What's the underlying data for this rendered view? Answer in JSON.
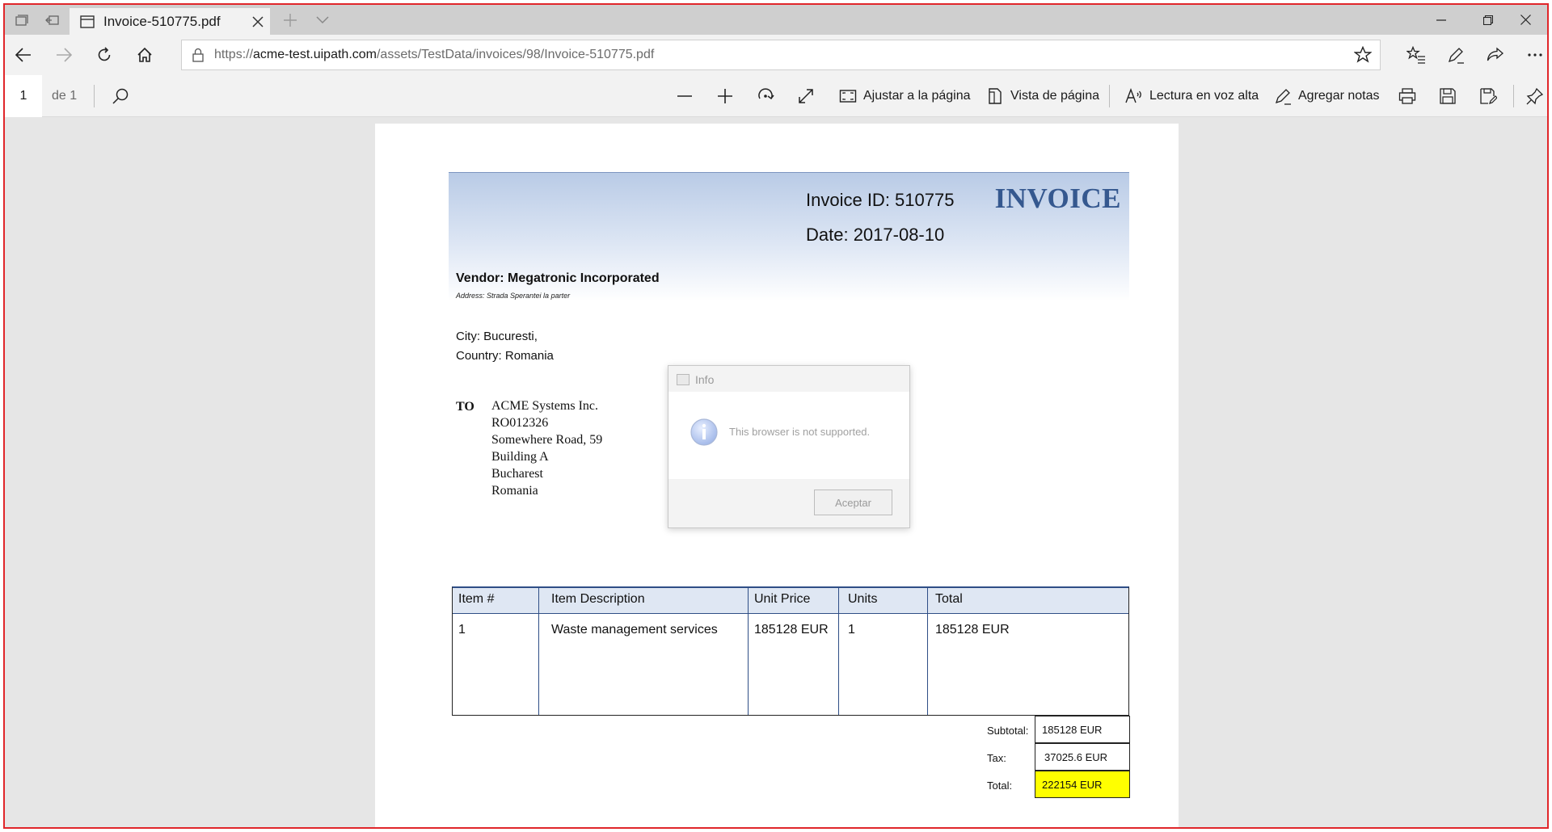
{
  "browser": {
    "tab_title": "Invoice-510775.pdf",
    "url_prefix": "https://",
    "url_host": "acme-test.uipath.com",
    "url_path": "/assets/TestData/invoices/98/Invoice-510775.pdf"
  },
  "pdf_toolbar": {
    "page_number": "1",
    "page_of": "de 1",
    "fit_page_label": "Ajustar a la página",
    "page_view_label": "Vista de página",
    "read_aloud_label": "Lectura en voz alta",
    "add_notes_label": "Agregar notas"
  },
  "invoice": {
    "heading": "INVOICE",
    "invoice_id": "Invoice ID: 510775",
    "date": "Date: 2017-08-10",
    "vendor": "Vendor: Megatronic Incorporated",
    "address": "Address: Strada Sperantei la parter",
    "city": "City: Bucuresti,",
    "country": "Country: Romania",
    "to_label": "TO",
    "to_lines": [
      "ACME Systems Inc.",
      "RO012326",
      "Somewhere Road, 59",
      "Building A",
      "Bucharest",
      "Romania"
    ],
    "columns": [
      "Item #",
      "Item Description",
      "Unit Price",
      "Units",
      "Total"
    ],
    "rows": [
      {
        "item": "1",
        "description": "Waste management services",
        "unit_price": "185128 EUR",
        "units": "1",
        "total": "185128 EUR"
      }
    ],
    "subtotal_label": "Subtotal:",
    "subtotal": "185128 EUR",
    "tax_label": "Tax:",
    "tax": "37025.6 EUR",
    "total_label": "Total:",
    "total": "222154 EUR",
    "total_highlight_color": "#ffff00"
  },
  "dialog": {
    "title": "Info",
    "message": "This browser is not supported.",
    "ok_label": "Aceptar"
  }
}
